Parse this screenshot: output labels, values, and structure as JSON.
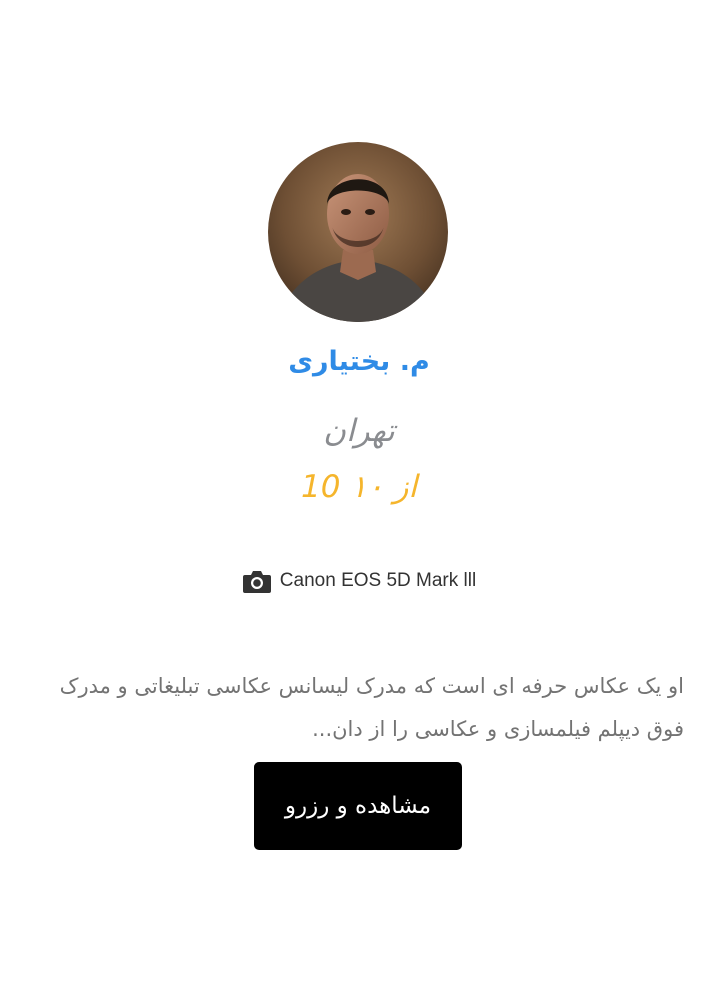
{
  "photographer": {
    "name": "م. بختیاری",
    "city": "تهران",
    "rating": "10 از ۱۰",
    "camera_model": "Canon EOS 5D Mark lll",
    "camera_icon": "camera-icon",
    "bio": "او یک عکاس حرفه ای است که مدرک لیسانس عکاسی تبلیغاتی و مدرک فوق دیپلم فیلمسازی و عکاسی را از دان...",
    "cta_label": "مشاهده و رزرو"
  },
  "colors": {
    "name": "#2f8be6",
    "city": "#8a8c90",
    "rating": "#f5b52c",
    "bio": "#737373",
    "button_bg": "#000000",
    "button_text": "#ffffff"
  }
}
